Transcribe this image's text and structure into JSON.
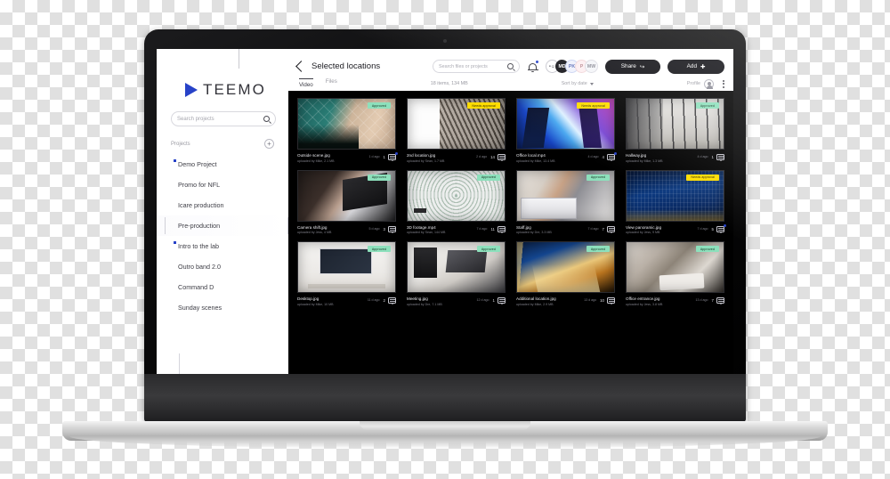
{
  "brand": {
    "name": "TEEMO",
    "logo_icon": "play-triangle-icon",
    "accent": "#2742c8"
  },
  "sidebar": {
    "search": {
      "placeholder": "Search projects",
      "icon": "search-icon"
    },
    "projects_label": "Projects",
    "add_project_icon": "plus-circle-icon",
    "items": [
      {
        "label": "Demo Project",
        "unread": true,
        "active": false
      },
      {
        "label": "Promo for NFL",
        "unread": false,
        "active": false
      },
      {
        "label": "Icare production",
        "unread": false,
        "active": false
      },
      {
        "label": "Pre-production",
        "unread": false,
        "active": true
      },
      {
        "label": "Intro to the lab",
        "unread": true,
        "active": false
      },
      {
        "label": "Outro band 2.0",
        "unread": false,
        "active": false
      },
      {
        "label": "Command D",
        "unread": false,
        "active": false
      },
      {
        "label": "Sunday scenes",
        "unread": false,
        "active": false
      }
    ]
  },
  "header": {
    "back_icon": "chevron-left-icon",
    "title": "Selected locations",
    "search": {
      "placeholder": "Search files or projects",
      "icon": "search-icon"
    },
    "bell_icon": "bell-icon",
    "bell_has_badge": true,
    "avatars": [
      {
        "initials": "",
        "kind": "add",
        "icon": "add-person-icon"
      },
      {
        "initials": "MD",
        "kind": "dark"
      },
      {
        "initials": "PK",
        "kind": "blue"
      },
      {
        "initials": "P",
        "kind": "pink"
      },
      {
        "initials": "MW",
        "kind": "gray"
      }
    ],
    "share_button": "Share",
    "share_icon": "share-arrow-icon",
    "add_button": "Add",
    "add_icon": "plus-icon"
  },
  "tabs": [
    {
      "label": "Video",
      "active": true
    },
    {
      "label": "Files",
      "active": false
    }
  ],
  "meta": {
    "count_text": "18 items, 134 MB",
    "sort_label": "Sort by date",
    "sort_icon": "chevron-down-icon",
    "profile_label": "Profile",
    "profile_icon": "avatar-icon",
    "more_icon": "kebab-menu-icon"
  },
  "status_colors": {
    "approved": "#8de0bc",
    "needs_approval": "#ffdc00"
  },
  "files": [
    {
      "name": "Outside scene.jpg",
      "uploader": "uploaded by Mike, 2.1 MB",
      "time": "1 d ago",
      "comments": "1",
      "badge": "Approved",
      "badge_kind": "approved",
      "art": "glass",
      "unread": true
    },
    {
      "name": "2nd location.jpg",
      "uploader": "uploaded by Sean, 1.7 MB",
      "time": "2 d ago",
      "comments": "14",
      "badge": "Needs approval",
      "badge_kind": "needs",
      "art": "facade",
      "unread": false
    },
    {
      "name": "Office local.mp4",
      "uploader": "uploaded by Mike, 13.4 MB",
      "time": "4 d ago",
      "comments": "4",
      "badge": "Needs approval",
      "badge_kind": "needs",
      "art": "skyline",
      "unread": true
    },
    {
      "name": "Hallway.jpg",
      "uploader": "uploaded by Mike, 1.3 MB",
      "time": "4 d ago",
      "comments": "1",
      "badge": "Approved",
      "badge_kind": "approved",
      "art": "hallway",
      "unread": false
    },
    {
      "name": "Camera shift.jpg",
      "uploader": "uploaded by Jess, 4 MB",
      "time": "5 d ago",
      "comments": "3",
      "badge": "Approved",
      "badge_kind": "approved",
      "art": "laptop-hand",
      "unread": false
    },
    {
      "name": "3D footage.mp4",
      "uploader": "uploaded by Sean, 144 MB",
      "time": "7 d ago",
      "comments": "11",
      "badge": "Approved",
      "badge_kind": "approved",
      "art": "threed",
      "unread": false
    },
    {
      "name": "Staff.jpg",
      "uploader": "uploaded by Dre, 3.3 MB",
      "time": "7 d ago",
      "comments": "7",
      "badge": "Approved",
      "badge_kind": "approved",
      "art": "staff",
      "unread": false
    },
    {
      "name": "View panoramic.jpg",
      "uploader": "uploaded by Jess, 9 MB",
      "time": "7 d ago",
      "comments": "5",
      "badge": "Needs approval",
      "badge_kind": "needs",
      "art": "night-city",
      "unread": true
    },
    {
      "name": "Desktop.jpg",
      "uploader": "uploaded by Mike, 10 MB",
      "time": "11 d ago",
      "comments": "2",
      "badge": "Approved",
      "badge_kind": "approved",
      "art": "desk-setup",
      "unread": false
    },
    {
      "name": "Meeting.jpg",
      "uploader": "uploaded by Dre, 7.1 MB",
      "time": "12 d ago",
      "comments": "1",
      "badge": "Approved",
      "badge_kind": "approved",
      "art": "meeting",
      "unread": false
    },
    {
      "name": "Additional location.jpg",
      "uploader": "uploaded by Mike, 2.9 MB",
      "time": "13 d ago",
      "comments": "10",
      "badge": "Approved",
      "badge_kind": "approved",
      "art": "traffic",
      "unread": false
    },
    {
      "name": "Office entrance.jpg",
      "uploader": "uploaded by Jess, 3.8 MB",
      "time": "13 d ago",
      "comments": "7",
      "badge": "Approved",
      "badge_kind": "approved",
      "art": "office-entrance",
      "unread": false
    }
  ]
}
